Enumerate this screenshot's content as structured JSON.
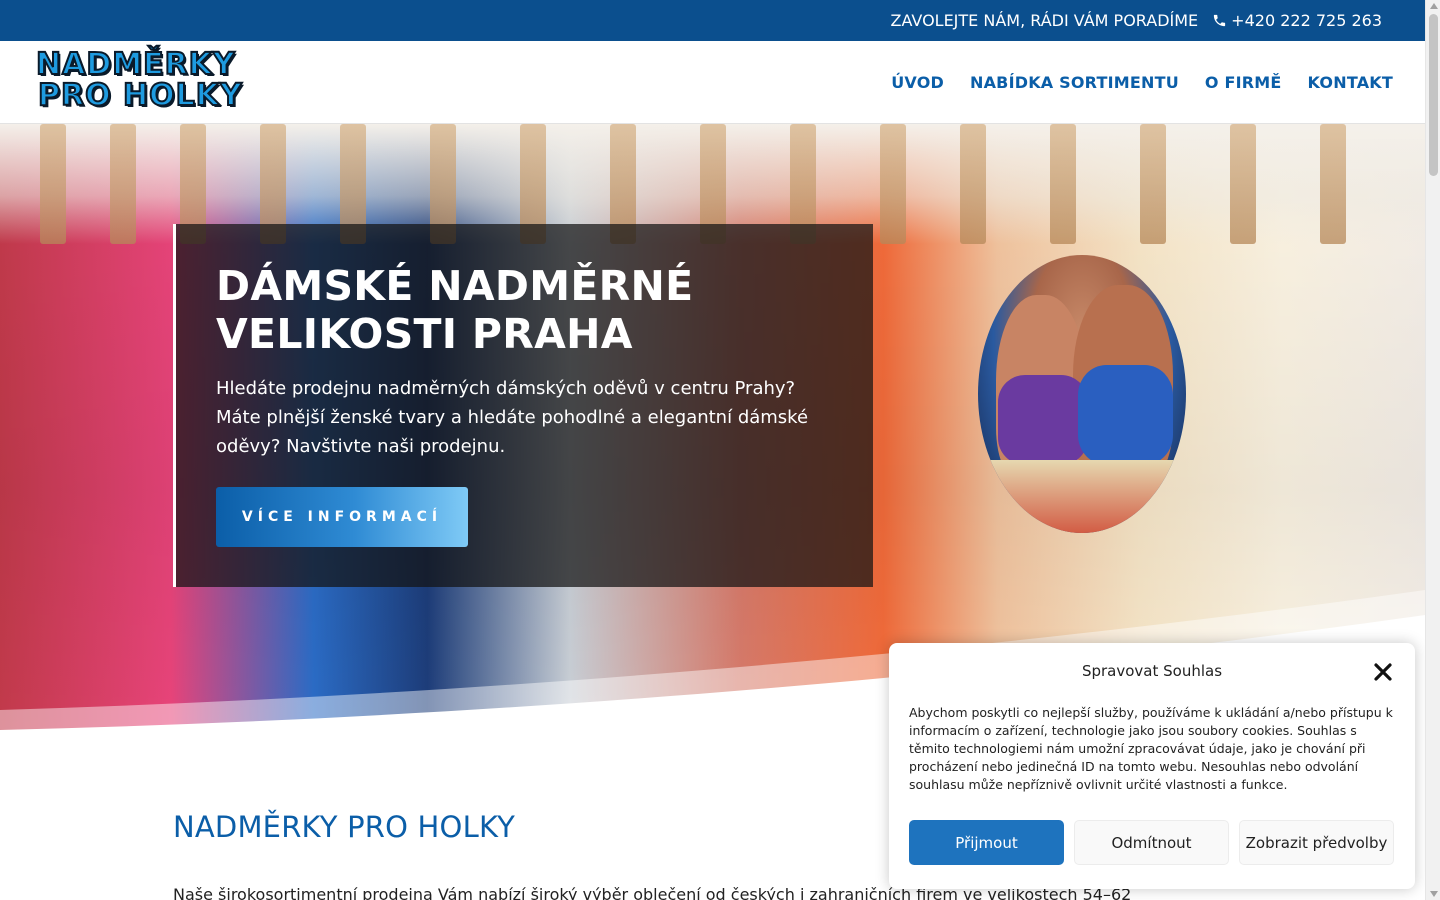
{
  "topbar": {
    "callout": "ZAVOLEJTE NÁM, RÁDI VÁM PORADÍME",
    "phone": "+420 222 725 263",
    "phone_icon": "phone-icon",
    "background": "#0b4f8e"
  },
  "header": {
    "logo_line1": "NADMĚRKY",
    "logo_line2": "PRO HOLKY",
    "nav": [
      {
        "label": "ÚVOD"
      },
      {
        "label": "NABÍDKA SORTIMENTU"
      },
      {
        "label": "O FIRMĚ"
      },
      {
        "label": "KONTAKT"
      }
    ],
    "nav_color": "#0b5ea8"
  },
  "hero": {
    "title": "DÁMSKÉ NADMĚRNÉ VELIKOSTI PRAHA",
    "text": "Hledáte prodejnu nadměrných dámských oděvů v centru Prahy? Máte plnější ženské tvary a hledáte pohodlné a elegantní dámské oděvy? Navštivte naši prodejnu.",
    "button": "VÍCE INFORMACÍ"
  },
  "content": {
    "title": "NADMĚRKY PRO HOLKY",
    "text": "Naše širokosortimentní prodejna Vám nabízí široký výběr oblečení od českých i zahraničních firem ve velikostech 54–62"
  },
  "cookie": {
    "title": "Spravovat Souhlas",
    "close_icon": "close-icon",
    "text": "Abychom poskytli co nejlepší služby, používáme k ukládání a/nebo přístupu k informacím o zařízení, technologie jako jsou soubory cookies. Souhlas s těmito technologiemi nám umožní zpracovávat údaje, jako je chování při procházení nebo jedinečná ID na tomto webu. Nesouhlas nebo odvolání souhlasu může nepříznivě ovlivnit určité vlastnosti a funkce.",
    "accept": "Přijmout",
    "deny": "Odmítnout",
    "prefs": "Zobrazit předvolby",
    "accent": "#1e73be"
  }
}
